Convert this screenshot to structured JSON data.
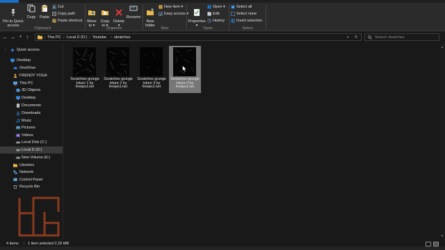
{
  "ribbon": {
    "clipboard": {
      "pin_label": "Pin to Quick\naccess",
      "copy_label": "Copy",
      "paste_label": "Paste",
      "cut_label": "Cut",
      "copy_path_label": "Copy path",
      "paste_shortcut_label": "Paste shortcut",
      "group_label": "Clipboard"
    },
    "organize": {
      "move_to_label": "Move\nto ▾",
      "copy_to_label": "Copy\nto ▾",
      "delete_label": "Delete\n▾",
      "rename_label": "Rename",
      "group_label": "Organize"
    },
    "new": {
      "new_item_label": "New item ▾",
      "easy_access_label": "Easy access ▾",
      "new_folder_label": "New\nfolder",
      "group_label": "New"
    },
    "open": {
      "properties_label": "Properties\n▾",
      "open_label": "Open ▾",
      "edit_label": "Edit",
      "history_label": "History",
      "group_label": "Open"
    },
    "select": {
      "select_all_label": "Select all",
      "select_none_label": "Select none",
      "invert_selection_label": "Invert selection",
      "group_label": "Select"
    }
  },
  "address": {
    "crumbs": [
      "This PC",
      "Local D (D:)",
      "Youtube",
      "skratches"
    ],
    "search_placeholder": "Search skratches"
  },
  "sidebar": {
    "items": [
      {
        "label": "Quick access",
        "icon": "star-icon"
      },
      {
        "label": "Desktop",
        "icon": "desktop-icon"
      },
      {
        "label": "OneDrive",
        "icon": "cloud-icon"
      },
      {
        "label": "FRENDY YOGA",
        "icon": "user-icon"
      },
      {
        "label": "This PC",
        "icon": "pc-icon"
      },
      {
        "label": "3D Objects",
        "icon": "cube-icon"
      },
      {
        "label": "Desktop",
        "icon": "desktop-icon"
      },
      {
        "label": "Documents",
        "icon": "document-icon"
      },
      {
        "label": "Downloads",
        "icon": "download-icon"
      },
      {
        "label": "Music",
        "icon": "music-icon"
      },
      {
        "label": "Pictures",
        "icon": "pictures-icon"
      },
      {
        "label": "Videos",
        "icon": "video-icon"
      },
      {
        "label": "Local Disk (C:)",
        "icon": "drive-icon"
      },
      {
        "label": "Local D (D:)",
        "icon": "drive-icon"
      },
      {
        "label": "New Volume (E:)",
        "icon": "drive-icon"
      },
      {
        "label": "Libraries",
        "icon": "library-icon"
      },
      {
        "label": "Network",
        "icon": "network-icon"
      },
      {
        "label": "Control Panel",
        "icon": "control-panel-icon"
      },
      {
        "label": "Recycle Bin",
        "icon": "recycle-bin-icon"
      }
    ]
  },
  "files": [
    {
      "name": "Scratches grunge txture 1 by freeject.net",
      "selected": false
    },
    {
      "name": "Scratches grunge txture 2 by freeject.net",
      "selected": false
    },
    {
      "name": "Scratches grunge txture 3 by freeject.net",
      "selected": false
    },
    {
      "name": "Scratches grunge txture 4 by freeject.net",
      "selected": true
    }
  ],
  "status": {
    "item_count": "4 items",
    "selection": "1 item selected  2.29 MB"
  },
  "colors": {
    "accent": "#1a6fc4",
    "folder": "#e8b84a",
    "selection": "#777777",
    "logo": "#8a3a1f"
  }
}
